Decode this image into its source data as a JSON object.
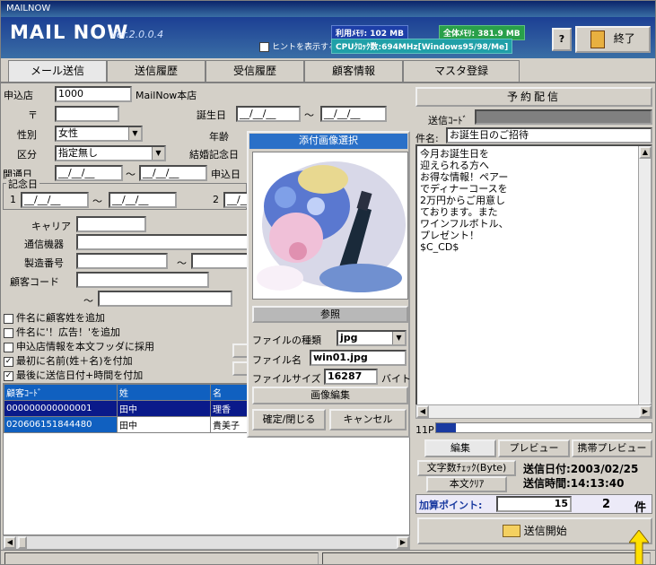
{
  "window": {
    "title": "MAILNOW"
  },
  "header": {
    "logo": "MAIL NOW",
    "version": "Ver.2.0.0.4",
    "free_mem": "利用ﾒﾓﾘ: 102 MB",
    "total_mem": "全体ﾒﾓﾘ: 381.9 MB",
    "cpu": "CPUｸﾛｯｸ数:694MHz[Windows95/98/Me]",
    "hint_label": "ヒントを表示する",
    "help_label": "?",
    "exit_label": "終了"
  },
  "tabs": [
    "メール送信",
    "送信履歴",
    "受信履歴",
    "顧客情報",
    "マスタ登録"
  ],
  "form": {
    "store_label": "申込店",
    "store_code": "1000",
    "store_name": "MailNow本店",
    "zip_label": "〒",
    "birthday_label": "誕生日",
    "date_blank": "__/__/__",
    "tilde": "〜",
    "gender_label": "性別",
    "gender_value": "女性",
    "age_label": "年齢",
    "class_label": "区分",
    "class_value": "指定無し",
    "anniv_label": "結婚記念日",
    "open_label": "開通日",
    "apply_label": "申込日",
    "memorial_label": "記念日",
    "memorial_1": "1",
    "memorial_2": "2",
    "carrier_label": "キャリア",
    "device_label": "通信機器",
    "serial_label": "製造番号",
    "customer_code_label": "顧客コード"
  },
  "checkboxes": [
    {
      "label": "件名に顧客姓を追加",
      "checked": false
    },
    {
      "label": "件名に'！広告！'を追加",
      "checked": false
    },
    {
      "label": "申込店情報を本文フッダに採用",
      "checked": false
    },
    {
      "label": "最初に名前(姓＋名)を付加",
      "checked": true
    },
    {
      "label": "最後に送信日付+時間を付加",
      "checked": true
    }
  ],
  "table": {
    "headers": [
      "顧客ｺｰﾄﾞ",
      "姓",
      "名"
    ],
    "rows": [
      [
        "000000000000001",
        "田中",
        "理香"
      ],
      [
        "020606151844480",
        "田中",
        "貴美子"
      ]
    ]
  },
  "image_dialog": {
    "title": "添付画像選択",
    "browse_label": "参照",
    "filetype_label": "ファイルの種類",
    "filetype_value": "jpg",
    "filename_label": "ファイル名",
    "filename_value": "win01.jpg",
    "filesize_label": "ファイルサイズ",
    "filesize_value": "16287",
    "filesize_unit": "バイト",
    "edit_label": "画像編集",
    "ok_label": "確定/閉じる",
    "cancel_label": "キャンセル"
  },
  "right": {
    "reserve_label": "予約配信",
    "send_code_label": "送信ｺｰﾄﾞ",
    "subject_label": "件名:",
    "subject_value": "お誕生日のご招待",
    "body_lines": [
      "今月お誕生日を",
      "迎えられる方へ",
      "お得な情報！ペアー",
      "でディナーコースを",
      "2万円からご用意し",
      "ております。また",
      "ワインフルボトル、",
      "プレゼント！",
      "$C_CD$"
    ],
    "progress_label": "11P",
    "progress": 0.09,
    "tab_edit": "編集",
    "tab_preview": "プレビュー",
    "tab_mobile": "携帯プレビュー",
    "charcheck_label": "文字数ﾁｪｯｸ(Byte)",
    "clear_label": "本文ｸﾘｱ",
    "send_date": "送信日付:2003/02/25",
    "send_time": "送信時間:14:13:40",
    "points_label": "加算ポイント:",
    "points_value": "15",
    "count_value": "2",
    "count_unit": "件",
    "send_label": "送信開始"
  }
}
